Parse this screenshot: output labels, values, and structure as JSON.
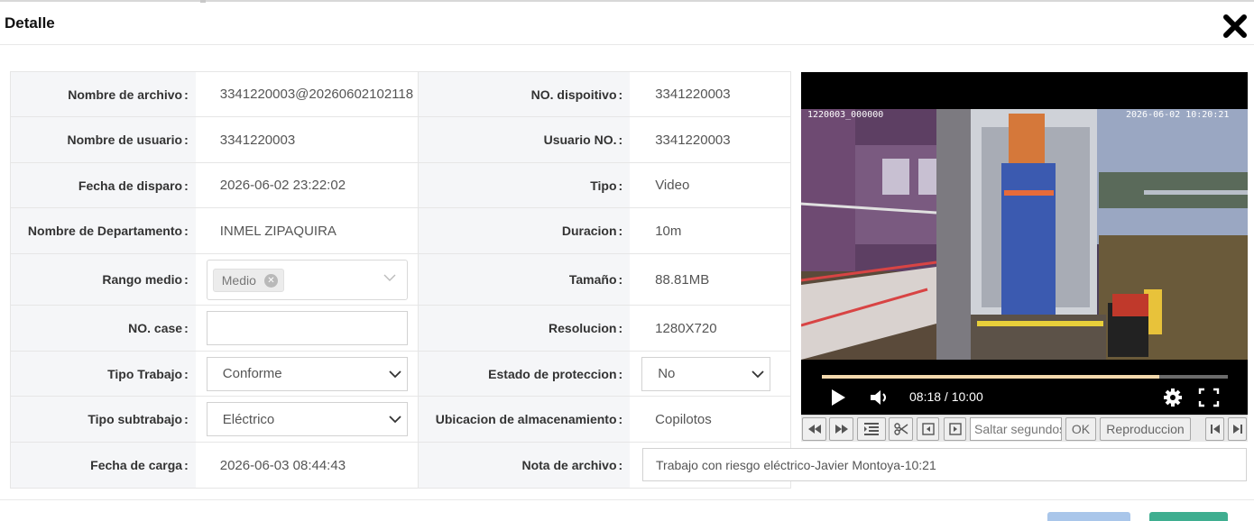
{
  "dialog": {
    "title": "Detalle"
  },
  "fields": {
    "file_name": {
      "label": "Nombre de archivo",
      "value": "3341220003@20260602102118"
    },
    "device_no": {
      "label": "NO. dispoitivo",
      "value": "3341220003"
    },
    "user_name": {
      "label": "Nombre de usuario",
      "value": "3341220003"
    },
    "user_no": {
      "label": "Usuario NO.",
      "value": "3341220003"
    },
    "trigger_date": {
      "label": "Fecha de disparo",
      "value": "2026-06-02 23:22:02"
    },
    "type": {
      "label": "Tipo",
      "value": "Video"
    },
    "department": {
      "label": "Nombre de Departamento",
      "value": "INMEL ZIPAQUIRA"
    },
    "duration": {
      "label": "Duracion",
      "value": "10m"
    },
    "media_range": {
      "label": "Rango medio",
      "tag": "Medio"
    },
    "size": {
      "label": "Tamaño",
      "value": "88.81MB"
    },
    "case_no": {
      "label": "NO. case",
      "value": ""
    },
    "resolution": {
      "label": "Resolucion",
      "value": "1280X720"
    },
    "work_type": {
      "label": "Tipo Trabajo",
      "value": "Conforme"
    },
    "protection_state": {
      "label": "Estado de proteccion",
      "value": "No"
    },
    "work_subtype": {
      "label": "Tipo subtrabajo",
      "value": "Eléctrico"
    },
    "storage_location": {
      "label": "Ubicacion de almacenamiento",
      "value": "Copilotos"
    },
    "upload_date": {
      "label": "Fecha de carga",
      "value": "2026-06-03 08:44:43"
    },
    "file_note": {
      "label": "Nota de archivo",
      "value": "Trabajo con riesgo eléctrico-Javier Montoya-10:21"
    }
  },
  "colon": ":",
  "video": {
    "osd_left": "1220003_000000",
    "osd_right": "2026-06-02  10:20:21",
    "time_display": "08:18 / 10:00",
    "progress": 0.83
  },
  "toolbar": {
    "seek_placeholder": "Saltar segundos",
    "ok_label": "OK",
    "playback_label": "Reproduccion"
  },
  "icons": [
    "close-icon",
    "play-icon",
    "volume-icon",
    "settings-gear-icon",
    "fullscreen-icon",
    "rewind-icon",
    "fast-forward-icon",
    "list-icon",
    "scissors-icon",
    "prev-frame-icon",
    "next-frame-icon",
    "skip-start-icon",
    "skip-end-icon",
    "chevron-down-icon",
    "tag-remove-icon"
  ],
  "colors": {
    "primary_button": "#a9c6ea",
    "confirm_button": "#3fae90",
    "progress_fill": "#f3d9ad"
  }
}
